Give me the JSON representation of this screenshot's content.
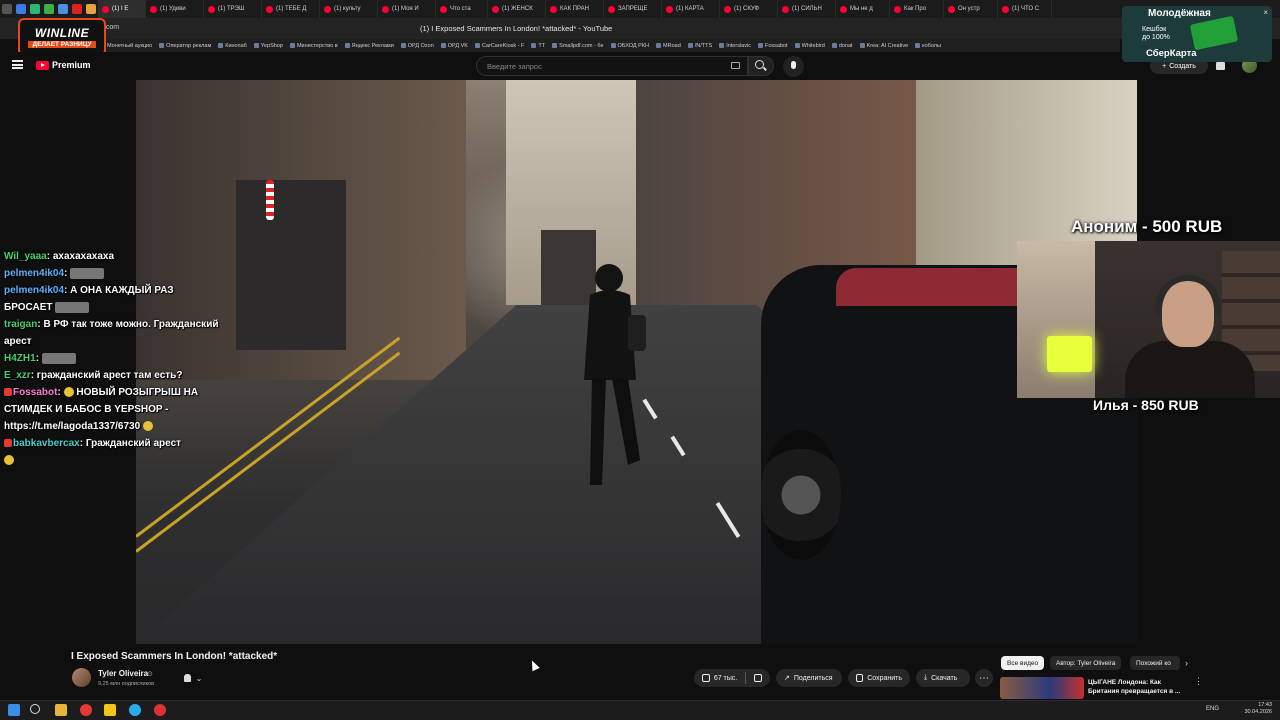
{
  "browser": {
    "tabs": [
      {
        "label": "(1) I E"
      },
      {
        "label": "(1) Удиви"
      },
      {
        "label": "(1) ТРЭШ"
      },
      {
        "label": "(1) ТЕБЕ Д"
      },
      {
        "label": "(1) культу"
      },
      {
        "label": "(1) Моя И"
      },
      {
        "label": "Что ста"
      },
      {
        "label": "(1) ЖЕНСК"
      },
      {
        "label": "КАК ПРАН"
      },
      {
        "label": "ЗАПРЕЩЕ"
      },
      {
        "label": "(1) КАРТА"
      },
      {
        "label": "(1) СКУФ"
      },
      {
        "label": "(1) СИЛЬН"
      },
      {
        "label": "Мы не д"
      },
      {
        "label": "Как Про"
      },
      {
        "label": "Он устр"
      },
      {
        "label": "(1) ЧТО С"
      }
    ],
    "url": "e.com",
    "window_title": "(1) I Exposed Scammers In London! *attacked* - YouTube",
    "bookmarks": [
      "Монетный аукцио",
      "Оператор реклам",
      "Кинопаб",
      "YepShop",
      "Министерство в",
      "Яндекс Реклами",
      "ОРД Ozon",
      "ОРД VK",
      "CarCareKiosk - F",
      "TT",
      "Smallpdf.com - бе",
      "ОБХОД РКН",
      "MRoad",
      "/N/TTS",
      "Interslavic",
      "Fossabot",
      "Whitebird",
      "donat",
      "Krea: AI Creative",
      "коболы"
    ]
  },
  "overlays": {
    "winline": {
      "brand": "WINLINE",
      "tagline": "ДЕЛАЕТ РАЗНИЦУ"
    },
    "sber_ad": {
      "title": "Молодёжная",
      "line1": "Кешбэк",
      "line2": "до 100%",
      "brand": "СберКарта",
      "close": "×"
    },
    "donations": [
      "Аноним - 500 RUB",
      "Илья - 850 RUB"
    ]
  },
  "youtube": {
    "logo_text": "Premium",
    "search_placeholder": "Введите запрос",
    "create_label": "Создать",
    "video_title": "I Exposed Scammers In London! *attacked*",
    "channel": {
      "name": "Tyler Oliveira",
      "verified": "⊙",
      "subscribers": "9,25 млн подписчиков"
    },
    "actions": {
      "likes": "67 тыс.",
      "share": "Поделиться",
      "save": "Сохранить",
      "download": "Скачать",
      "more": "⋯"
    },
    "chips": [
      "Все видео",
      "Автор: Tyler Oliveira",
      "Похожий ко"
    ],
    "recommendation": {
      "title": "ЦЫГАНЕ Лондона: Как Британия превращается в ..."
    }
  },
  "chat": [
    {
      "user": "Wil_yaaa",
      "color": "green",
      "msg": "ахахахахаха",
      "emote": ""
    },
    {
      "user": "pelmen4ik04",
      "color": "blue",
      "msg": "",
      "emote": "emote"
    },
    {
      "user": "pelmen4ik04",
      "color": "blue",
      "msg": "А ОНА КАЖДЫЙ РАЗ БРОСАЕТ",
      "emote": "emote"
    },
    {
      "user": "traigan",
      "color": "green",
      "msg": "В РФ так тоже можно. Гражданский арест",
      "emote": ""
    },
    {
      "user": "H4ZH1",
      "color": "green",
      "msg": "",
      "emote": "emote"
    },
    {
      "user": "E_xzr",
      "color": "green",
      "msg": "гражданский арест там есть?",
      "emote": ""
    },
    {
      "user": "Fossabot",
      "color": "pink",
      "msg": "НОВЫЙ РОЗЫГРЫШ НА СТИМДЕК И БАБОС В YEPSHOP - https://t.me/lagoda1337/6730",
      "emote": "yel"
    },
    {
      "user": "babkavbercax",
      "color": "cyan",
      "msg": "Гражданский арест",
      "emote": "yel"
    }
  ],
  "taskbar": {
    "lang": "ENG",
    "time": "17:43",
    "date": "30.04.2026"
  }
}
